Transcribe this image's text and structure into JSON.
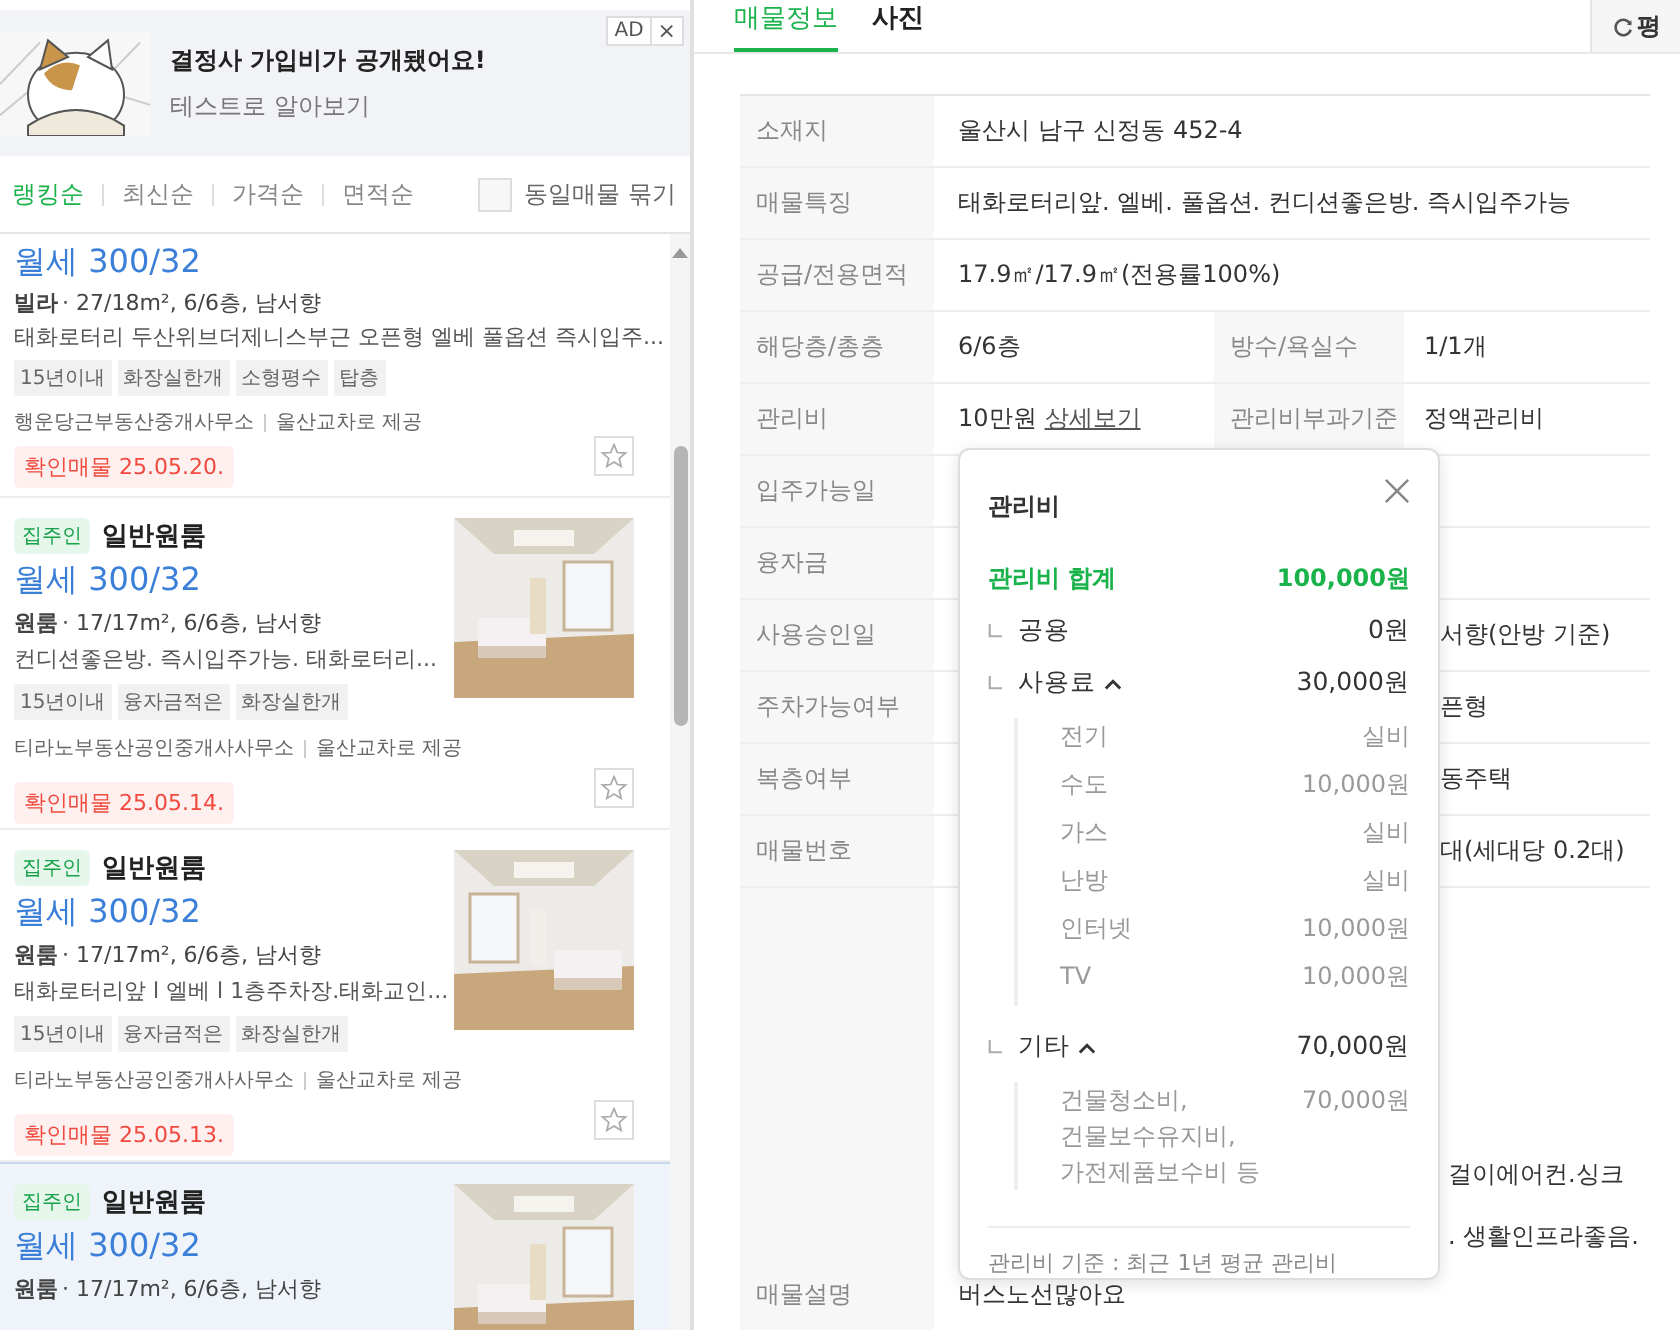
{
  "ad": {
    "badge": "AD",
    "close": "×",
    "title": "결정사 가입비가 공개됐어요!",
    "subtitle": "테스트로 알아보기",
    "picture": {
      "kind": "picture"
    }
  },
  "sort": {
    "options": [
      {
        "label": "랭킹순",
        "selected": true
      },
      {
        "label": "최신순",
        "selected": false
      },
      {
        "label": "가격순",
        "selected": false
      },
      {
        "label": "면적순",
        "selected": false
      }
    ],
    "group_checkbox": {
      "label": "동일매물 묶기",
      "checked": false
    }
  },
  "listings": [
    {
      "selected": false,
      "price": "월세 300/32",
      "type": "빌라",
      "info": "· 27/18m², 6/6층, 남서향",
      "desc": "태화로터리 두산위브더제니스부근 오픈형 엘베 풀옵션 즉시입주...",
      "tags": [
        "15년이내",
        "화장실한개",
        "소형평수",
        "탑층"
      ],
      "agent": "행운당근부동산중개사무소",
      "provider": "울산교차로 제공",
      "confirm": "확인매물 25.05.20.",
      "favorite": false
    },
    {
      "selected": false,
      "badge": "집주인",
      "title": "일반원룸",
      "price": "월세 300/32",
      "type": "원룸",
      "info": "· 17/17m², 6/6층, 남서향",
      "desc": "컨디션좋은방. 즉시입주가능. 태화로터리...",
      "tags": [
        "15년이내",
        "융자금적은",
        "화장실한개"
      ],
      "agent": "티라노부동산공인중개사사무소",
      "provider": "울산교차로 제공",
      "confirm": "확인매물 25.05.14.",
      "favorite": false,
      "photo": {
        "kind": "picture"
      }
    },
    {
      "selected": false,
      "badge": "집주인",
      "title": "일반원룸",
      "price": "월세 300/32",
      "type": "원룸",
      "info": "· 17/17m², 6/6층, 남서향",
      "desc": "태화로터리앞 l 엘베 l 1층주차장.태화교인...",
      "tags": [
        "15년이내",
        "융자금적은",
        "화장실한개"
      ],
      "agent": "티라노부동산공인중개사사무소",
      "provider": "울산교차로 제공",
      "confirm": "확인매물 25.05.13.",
      "favorite": false,
      "photo": {
        "kind": "picture"
      }
    },
    {
      "selected": true,
      "badge": "집주인",
      "title": "일반원룸",
      "price": "월세 300/32",
      "type": "원룸",
      "info": "· 17/17m², 6/6층, 남서향",
      "photo": {
        "kind": "picture"
      }
    }
  ],
  "tabs": [
    {
      "label": "매물정보",
      "selected": true
    },
    {
      "label": "사진",
      "selected": false
    }
  ],
  "unit_button": {
    "label": "평"
  },
  "table": {
    "rows": [
      {
        "cells": [
          {
            "label": "소재지",
            "value": "울산시 남구 신정동 452-4"
          }
        ]
      },
      {
        "cells": [
          {
            "label": "매물특징",
            "value": "태화로터리앞. 엘베. 풀옵션. 컨디션좋은방. 즉시입주가능"
          }
        ]
      },
      {
        "cells": [
          {
            "label": "공급/전용면적",
            "value": "17.9㎡/17.9㎡(전용률100%)"
          }
        ]
      },
      {
        "cells": [
          {
            "label": "해당층/총층",
            "value": "6/6층"
          },
          {
            "label": "방수/욕실수",
            "value": "1/1개"
          }
        ]
      },
      {
        "cells": [
          {
            "label": "관리비",
            "value": "10만원",
            "link": "상세보기"
          },
          {
            "label": "관리비부과기준",
            "value": "정액관리비"
          }
        ]
      },
      {
        "cells": [
          {
            "label": "입주가능일"
          }
        ]
      },
      {
        "cells": [
          {
            "label": "융자금"
          }
        ]
      },
      {
        "cells": [
          {
            "label": "사용승인일"
          },
          {
            "value": "서향(안방 기준)"
          }
        ]
      },
      {
        "cells": [
          {
            "label": "주차가능여부"
          },
          {
            "value": "픈형"
          }
        ]
      },
      {
        "cells": [
          {
            "label": "복층여부"
          },
          {
            "value": "동주택"
          }
        ]
      },
      {
        "cells": [
          {
            "label": "매물번호"
          },
          {
            "value": "대(세대당 0.2대)"
          }
        ]
      }
    ],
    "description": {
      "label": "매물설명",
      "lines": [
        "걸이에어컨.싱크",
        ". 생활인프라좋음."
      ],
      "last_line": "버스노선많아요"
    }
  },
  "popup": {
    "title": "관리비",
    "total": {
      "label": "관리비 합계",
      "value": "100,000원"
    },
    "groups": [
      {
        "kind": "plain",
        "label": "공용",
        "value": "0원"
      },
      {
        "kind": "expandable",
        "expanded": true,
        "label": "사용료",
        "value": "30,000원",
        "items": [
          {
            "label": "전기",
            "value": "실비"
          },
          {
            "label": "수도",
            "value": "10,000원"
          },
          {
            "label": "가스",
            "value": "실비"
          },
          {
            "label": "난방",
            "value": "실비"
          },
          {
            "label": "인터넷",
            "value": "10,000원"
          },
          {
            "label": "TV",
            "value": "10,000원"
          }
        ]
      },
      {
        "kind": "expandable",
        "expanded": true,
        "label": "기타",
        "value": "70,000원",
        "items": [
          {
            "label": "건물청소비,\n건물보수유지비,\n가전제품보수비 등",
            "value": "70,000원"
          }
        ]
      }
    ],
    "note": "관리비 기준 : 최근 1년 평균 관리비"
  }
}
